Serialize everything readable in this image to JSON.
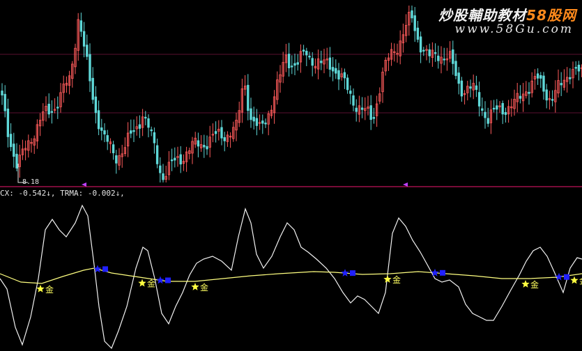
{
  "watermark": {
    "title_prefix": "炒股輔助教材",
    "title_accent": "58股网",
    "url": "www.58Gu.com"
  },
  "status_bar": {
    "line": "CX: -0.542↓, TRMA: -0.002↓,"
  },
  "low_label": "8.18",
  "colors": {
    "background": "#000000",
    "candle_up": "#ff5b5b",
    "candle_down": "#5fd8d8",
    "separator": "#a0104a",
    "grid": "#5a1030",
    "marker_triangle": "#c040ff",
    "cx_line": "#f2f2f2",
    "trma_line": "#ffff80",
    "gold_star": "#ffff40",
    "blue_star": "#2020ff",
    "signal_text": "#ffff60"
  },
  "chart_data": [
    {
      "type": "candlestick",
      "title": "",
      "price_label": "8.18"
    },
    {
      "type": "line",
      "title": "",
      "series": [
        {
          "name": "CX",
          "current": -0.542
        },
        {
          "name": "TRMA",
          "current": -0.002
        }
      ],
      "signals": [
        {
          "label": "金",
          "kind": "gold",
          "x": 58
        },
        {
          "label": "",
          "kind": "blue",
          "x": 140
        },
        {
          "label": "金",
          "kind": "gold",
          "x": 204
        },
        {
          "label": "",
          "kind": "blue",
          "x": 230
        },
        {
          "label": "金",
          "kind": "gold",
          "x": 280
        },
        {
          "label": "",
          "kind": "blue",
          "x": 495
        },
        {
          "label": "金",
          "kind": "gold",
          "x": 556
        },
        {
          "label": "",
          "kind": "blue",
          "x": 624
        },
        {
          "label": "金",
          "kind": "gold",
          "x": 754
        },
        {
          "label": "",
          "kind": "blue",
          "x": 802
        },
        {
          "label": "金",
          "kind": "gold",
          "x": 824
        }
      ]
    }
  ]
}
